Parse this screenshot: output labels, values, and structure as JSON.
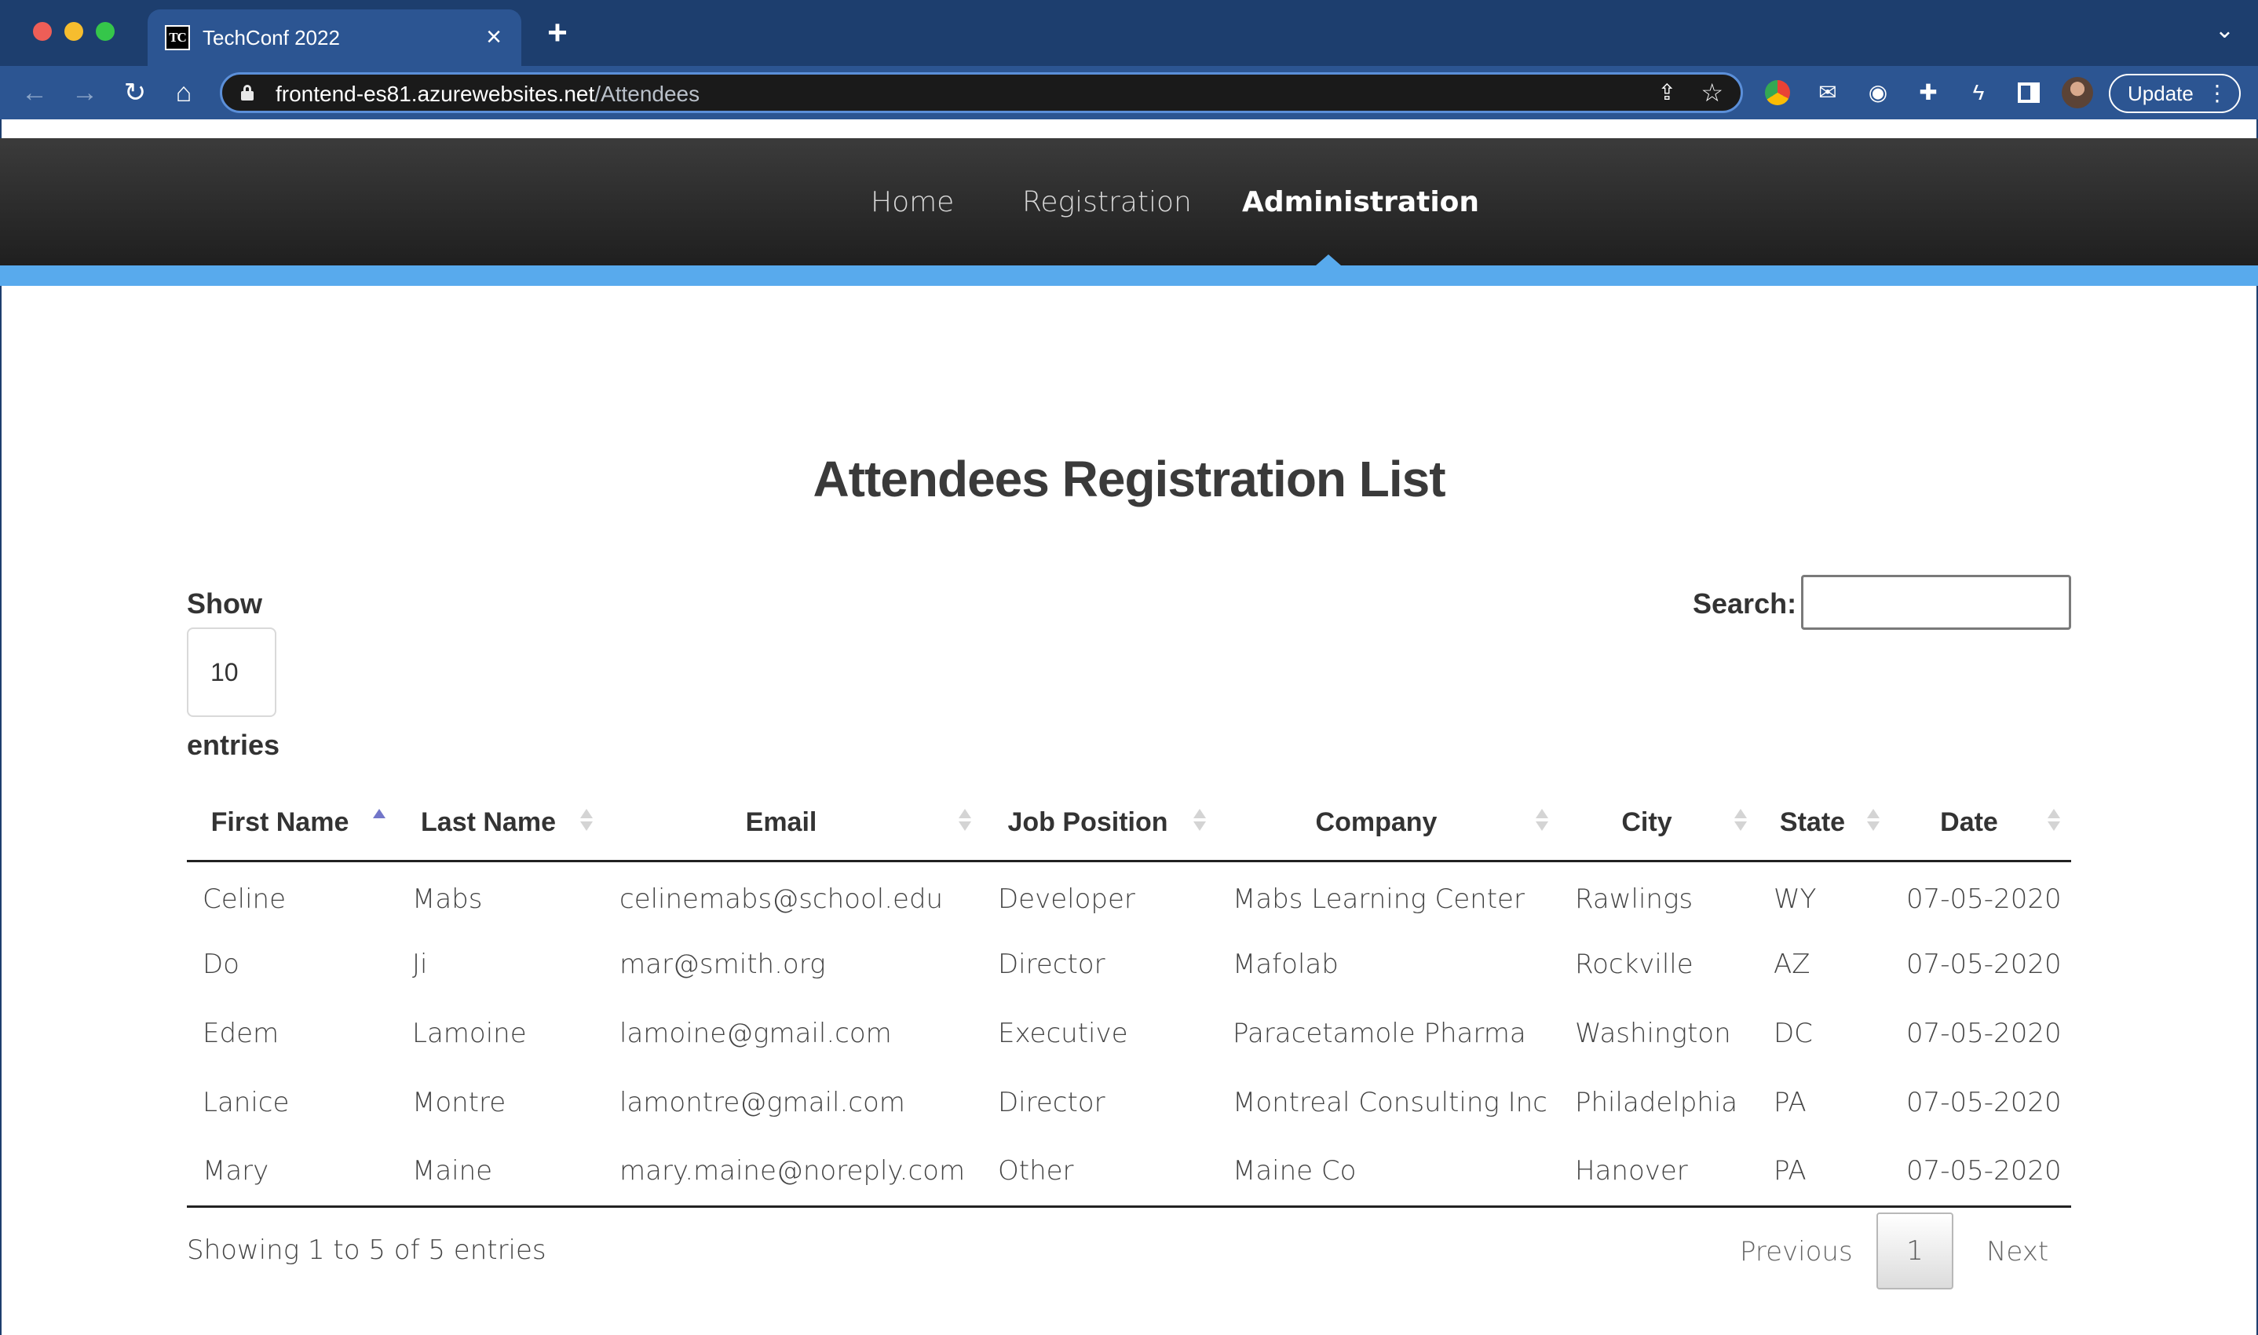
{
  "browser": {
    "tab_title": "TechConf 2022",
    "favicon_text": "TC",
    "url_host": "frontend-es81.azurewebsites.net",
    "url_path": "/Attendees",
    "update_label": "Update"
  },
  "nav": {
    "items": [
      {
        "label": "Home",
        "active": false
      },
      {
        "label": "Registration",
        "active": false
      },
      {
        "label": "Administration",
        "active": true
      }
    ]
  },
  "page": {
    "title": "Attendees Registration List",
    "show_label": "Show",
    "page_length": "10",
    "entries_label": "entries",
    "search_label": "Search:",
    "search_value": ""
  },
  "table": {
    "columns": [
      "First Name",
      "Last Name",
      "Email",
      "Job Position",
      "Company",
      "City",
      "State",
      "Date"
    ],
    "sorted_column": "First Name",
    "sort_direction": "ascending",
    "rows": [
      [
        "Celine",
        "Mabs",
        "celinemabs@school.edu",
        "Developer",
        "Mabs Learning Center",
        "Rawlings",
        "WY",
        "07-05-2020"
      ],
      [
        "Do",
        "Ji",
        "mar@smith.org",
        "Director",
        "Mafolab",
        "Rockville",
        "AZ",
        "07-05-2020"
      ],
      [
        "Edem",
        "Lamoine",
        "lamoine@gmail.com",
        "Executive",
        "Paracetamole Pharma",
        "Washington",
        "DC",
        "07-05-2020"
      ],
      [
        "Lanice",
        "Montre",
        "lamontre@gmail.com",
        "Director",
        "Montreal Consulting Inc",
        "Philadelphia",
        "PA",
        "07-05-2020"
      ],
      [
        "Mary",
        "Maine",
        "mary.maine@noreply.com",
        "Other",
        "Maine Co",
        "Hanover",
        "PA",
        "07-05-2020"
      ]
    ]
  },
  "footer": {
    "info": "Showing 1 to 5 of 5 entries",
    "previous_label": "Previous",
    "current_page": "1",
    "next_label": "Next"
  },
  "colors": {
    "accent_band": "#58aaed",
    "nav_background": "#2a2a2a",
    "browser_frame": "#1d3e6e",
    "sort_active": "#7276c9"
  }
}
